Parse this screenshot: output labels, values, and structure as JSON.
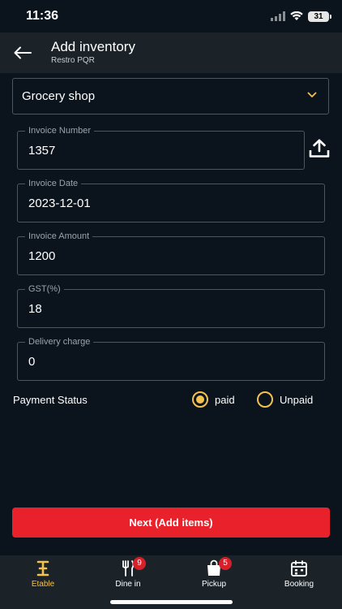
{
  "status_bar": {
    "time": "11:36",
    "battery": "31"
  },
  "header": {
    "title": "Add inventory",
    "subtitle": "Restro PQR"
  },
  "shop_select": {
    "value": "Grocery shop"
  },
  "fields": {
    "invoice_number": {
      "label": "Invoice Number",
      "value": "1357"
    },
    "invoice_date": {
      "label": "Invoice Date",
      "value": "2023-12-01"
    },
    "invoice_amount": {
      "label": "Invoice Amount",
      "value": "1200"
    },
    "gst": {
      "label": "GST(%)",
      "value": "18"
    },
    "delivery_charge": {
      "label": "Delivery charge",
      "value": "0"
    }
  },
  "payment_status": {
    "label": "Payment Status",
    "options": [
      {
        "label": "paid",
        "selected": true
      },
      {
        "label": "Unpaid",
        "selected": false
      }
    ]
  },
  "next_button": {
    "label": "Next (Add items)"
  },
  "bottom_nav": {
    "items": [
      {
        "label": "Etable",
        "icon": "etable-logo-icon",
        "active": true
      },
      {
        "label": "Dine in",
        "icon": "cutlery-icon",
        "badge": "9"
      },
      {
        "label": "Pickup",
        "icon": "shopping-bag-icon",
        "badge": "5"
      },
      {
        "label": "Booking",
        "icon": "calendar-icon"
      }
    ]
  },
  "colors": {
    "background": "#0b141d",
    "header": "#1b2329",
    "accent": "#f2c14e",
    "primary_button": "#e8212b",
    "badge": "#d6202a"
  }
}
